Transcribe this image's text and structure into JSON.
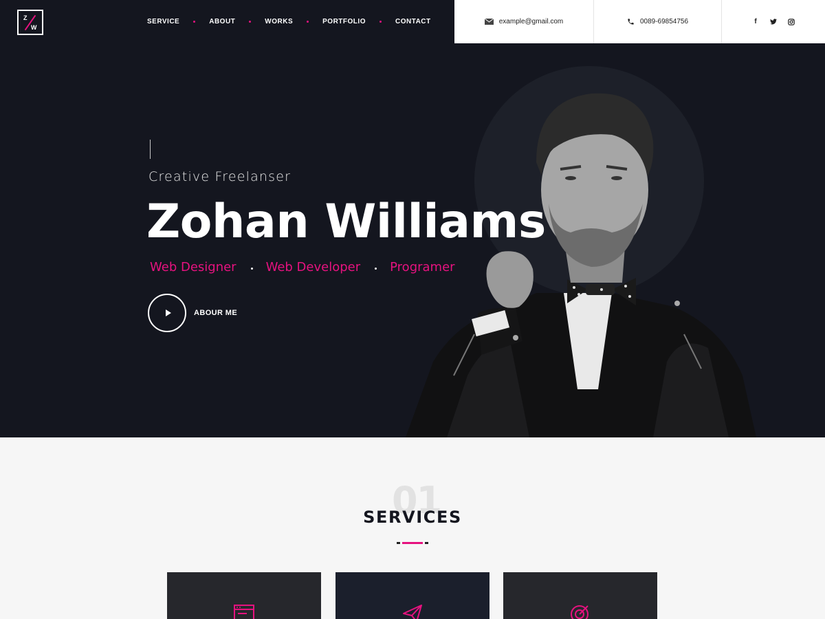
{
  "brand": {
    "logo_letter_top": "Z",
    "logo_letter_bottom": "W"
  },
  "nav": {
    "items": [
      "SERVICE",
      "ABOUT",
      "WORKS",
      "PORTFOLIO",
      "CONTACT"
    ]
  },
  "contact": {
    "email": "example@gmail.com",
    "phone": "0089-69854756"
  },
  "social": {
    "icons": [
      "facebook-icon",
      "twitter-icon",
      "instagram-icon"
    ],
    "facebook": "f",
    "twitter": "t",
    "instagram": "◙"
  },
  "hero": {
    "subtitle": "Creative Freelanser",
    "name": "Zohan Williams",
    "roles": [
      "Web Designer",
      "Web Developer",
      "Programer"
    ],
    "cta_label": "ABOUR ME"
  },
  "services": {
    "number": "01",
    "title": "SERVICES",
    "cards": [
      {
        "icon": "design-layout-icon"
      },
      {
        "icon": "paper-plane-icon"
      },
      {
        "icon": "target-icon"
      }
    ]
  },
  "colors": {
    "accent": "#e6127f",
    "dark": "#14161f",
    "light": "#f6f6f6"
  }
}
